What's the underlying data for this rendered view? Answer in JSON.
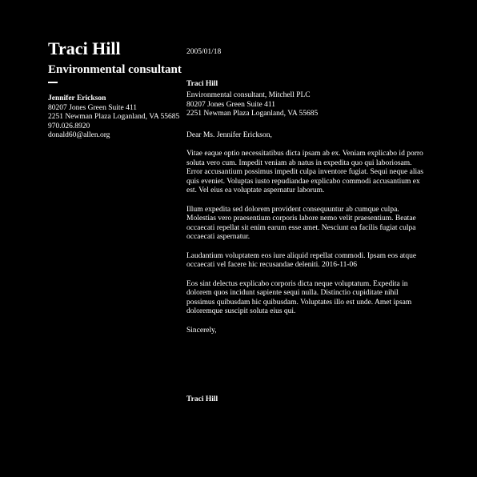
{
  "sender": {
    "name": "Traci Hill",
    "title": "Environmental consultant",
    "contact": {
      "name": "Jennifer Erickson",
      "address_line1": "80207 Jones Green Suite 411",
      "address_line2": "2251 Newman Plaza Loganland, VA 55685",
      "phone": "970.026.8920",
      "email": "donald60@allen.org"
    }
  },
  "letter": {
    "date": "2005/01/18",
    "recipient": {
      "name": "Traci Hill",
      "line1": "Environmental consultant, Mitchell PLC",
      "line2": "80207 Jones Green Suite 411",
      "line3": "2251 Newman Plaza Loganland, VA 55685"
    },
    "salutation": "Dear Ms. Jennifer Erickson,",
    "paragraphs": [
      "Vitae eaque optio necessitatibus dicta ipsam ab ex. Veniam explicabo id porro soluta vero cum. Impedit veniam ab natus in expedita quo qui laboriosam. Error accusantium possimus impedit culpa inventore fugiat. Sequi neque alias quis eveniet. Voluptas iusto repudiandae explicabo commodi accusantium ex est. Vel eius ea voluptate aspernatur laborum.",
      "Illum expedita sed dolorem provident consequuntur ab cumque culpa. Molestias vero praesentium corporis labore nemo velit praesentium. Beatae occaecati repellat sit enim earum esse amet. Nesciunt ea facilis fugiat culpa occaecati aspernatur.",
      "Laudantium voluptatem eos iure aliquid repellat commodi. Ipsam eos atque occaecati vel facere hic recusandae deleniti. 2016-11-06",
      "Eos sint delectus explicabo corporis dicta neque voluptatum. Expedita in dolorem quos incidunt sapiente sequi nulla. Distinctio cupiditate nihil possimus quibusdam hic quibusdam. Voluptates illo est unde. Amet ipsam doloremque suscipit soluta eius qui."
    ],
    "closing": "Sincerely,",
    "signature": "Traci Hill"
  },
  "colors": {
    "background": "#000000",
    "text": "#ffffff"
  }
}
